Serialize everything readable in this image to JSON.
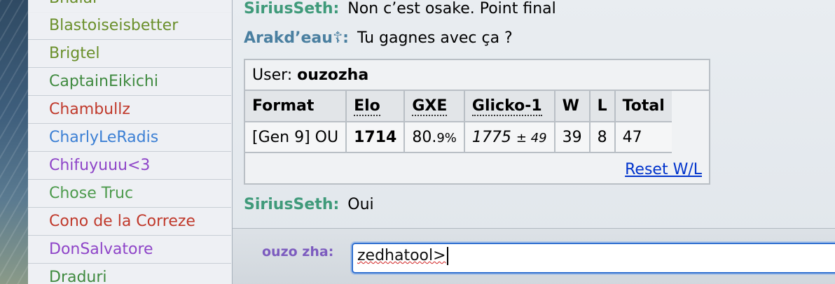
{
  "userlist": {
    "users": [
      {
        "name": "Bhalar",
        "color": "#6a8f2a"
      },
      {
        "name": "Blastoiseisbetter",
        "color": "#6a8f2a"
      },
      {
        "name": "Brigtel",
        "color": "#6a8f2a"
      },
      {
        "name": "CaptainEikichi",
        "color": "#3f8a3f"
      },
      {
        "name": "Chambullz",
        "color": "#c0392b"
      },
      {
        "name": "CharlyLeRadis",
        "color": "#3b7fd4"
      },
      {
        "name": "Chifuyuuu<3",
        "color": "#8e44c8"
      },
      {
        "name": "Chose Truc",
        "color": "#4c9a4c"
      },
      {
        "name": "Cono de la Correze",
        "color": "#c0392b"
      },
      {
        "name": "DonSalvatore",
        "color": "#8e44c8"
      },
      {
        "name": "Draduri",
        "color": "#3f8a3f"
      }
    ]
  },
  "chat": {
    "messages": [
      {
        "author": "SiriusSeth:",
        "author_color": "#3f9a7a",
        "text": "Non c’est osake. Point final"
      },
      {
        "author": "Arakd’eau☦:",
        "author_color": "#4a7fa0",
        "text": "Tu gagnes avec ça ?"
      },
      {
        "author": "SiriusSeth:",
        "author_color": "#3f9a7a",
        "text": "Oui"
      }
    ],
    "rank": {
      "user_label": "User:",
      "user_name": "ouzozha",
      "headers": [
        "Format",
        "Elo",
        "GXE",
        "Glicko-1",
        "W",
        "L",
        "Total"
      ],
      "row": {
        "format": "[Gen 9] OU",
        "elo": "1714",
        "gxe_main": "80.",
        "gxe_small": "9%",
        "glicko_main": "1775",
        "glicko_small": "± 49",
        "w": "39",
        "l": "8",
        "total": "47"
      },
      "reset_label": "Reset W/L"
    }
  },
  "composer": {
    "name": "ouzo zha:",
    "value": "zedhatool>"
  }
}
